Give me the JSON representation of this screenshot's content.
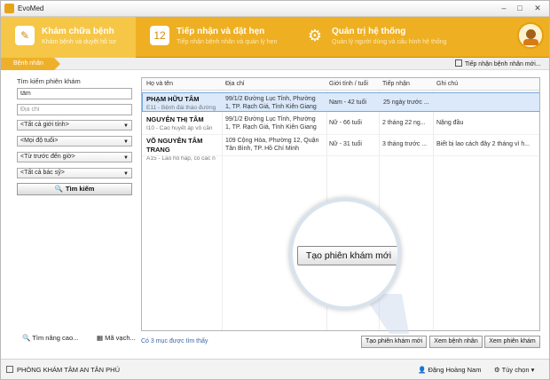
{
  "window": {
    "title": "EvoMed"
  },
  "nav": {
    "tabs": [
      {
        "title": "Khám chữa bệnh",
        "subtitle": "Khám bệnh và duyệt hồ sơ",
        "icon": "clipboard-icon"
      },
      {
        "title": "Tiếp nhận và đặt hẹn",
        "subtitle": "Tiếp nhận bệnh nhân và quản lý hẹn",
        "icon": "calendar-icon",
        "icon_text": "12"
      },
      {
        "title": "Quản trị hệ thống",
        "subtitle": "Quản lý người dùng và cấu hình hệ thống",
        "icon": "gear-icon"
      }
    ]
  },
  "breadcrumb": {
    "label": "Bệnh nhân"
  },
  "new_visit_link": "Tiếp nhận bệnh nhân mới...",
  "search": {
    "label": "Tìm kiếm phiên khám",
    "name_value": "tâm",
    "address_placeholder": "Địa chỉ",
    "gender": "<Tất cả giới tính>",
    "age": "<Mọi độ tuổi>",
    "time": "<Từ trước đến giờ>",
    "doctor": "<Tất cả bác sỹ>",
    "button": "Tìm kiếm",
    "advanced": "Tìm nâng cao...",
    "barcode": "Mã vạch..."
  },
  "table": {
    "columns": [
      "Họ và tên",
      "Địa chỉ",
      "Giới tính / tuổi",
      "Tiếp nhận",
      "Ghi chú"
    ],
    "rows": [
      {
        "name": "PHẠM HỮU TÂM",
        "sub": "E11 - Bệnh đái tháo đường",
        "address1": "99/1/2 Đường Lục Tỉnh, Phường",
        "address2": "1, TP. Rạch Giá, Tỉnh Kiên Giang",
        "gender_age": "Nam - 42 tuổi",
        "received": "25 ngày trước ...",
        "note": ""
      },
      {
        "name": "NGUYỄN THỊ TÂM",
        "sub": "I10 - Cao huyết áp vô căn",
        "address1": "99/1/2 Đường Lục Tỉnh, Phường",
        "address2": "1, TP. Rạch Giá, Tỉnh Kiên Giang",
        "gender_age": "Nữ - 66 tuổi",
        "received": "2 tháng 22 ng...",
        "note": "Nặng đầu"
      },
      {
        "name": "VÕ NGUYỄN TÂM TRANG",
        "sub": "A15 - Lao hô hấp, có các n",
        "address1": "109 Cộng Hòa, Phường 12, Quận",
        "address2": "Tân Bình, TP. Hồ Chí Minh",
        "gender_age": "Nữ - 31 tuổi",
        "received": "3 tháng trước ...",
        "note": "Biết bị lao cách đây 2 tháng vì h..."
      }
    ]
  },
  "found_text": "Có 3 mục được tìm thấy",
  "callout_label": "Tạo phiên khám mới",
  "actions": {
    "create": "Tạo phiên khám mới",
    "view_patient": "Xem bệnh nhân",
    "view_visit": "Xem phiên khám"
  },
  "status": {
    "clinic": "PHÒNG KHÁM TÂM AN TÂN PHÚ",
    "user": "Đặng Hoàng Nam",
    "options": "Tùy chọn"
  }
}
